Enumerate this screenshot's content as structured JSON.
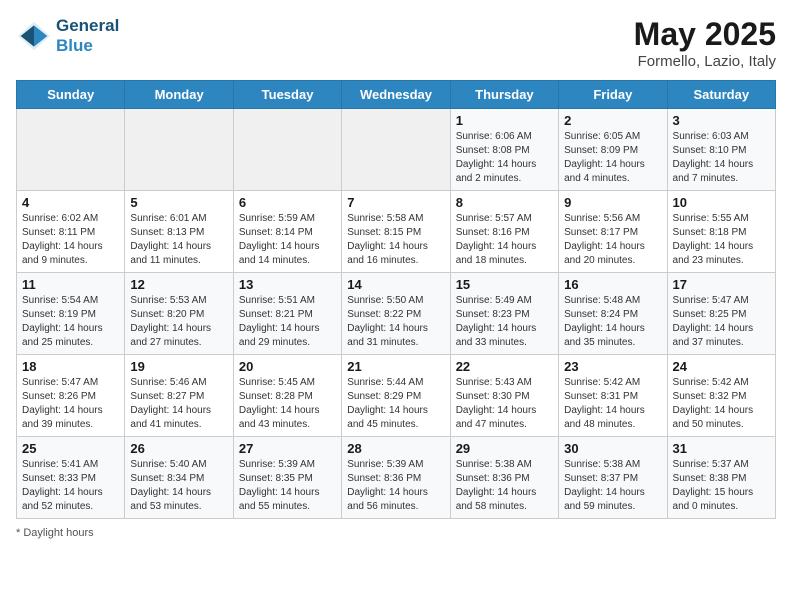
{
  "header": {
    "logo_line1": "General",
    "logo_line2": "Blue",
    "month": "May 2025",
    "location": "Formello, Lazio, Italy"
  },
  "weekdays": [
    "Sunday",
    "Monday",
    "Tuesday",
    "Wednesday",
    "Thursday",
    "Friday",
    "Saturday"
  ],
  "weeks": [
    [
      {
        "day": "",
        "info": ""
      },
      {
        "day": "",
        "info": ""
      },
      {
        "day": "",
        "info": ""
      },
      {
        "day": "",
        "info": ""
      },
      {
        "day": "1",
        "info": "Sunrise: 6:06 AM\nSunset: 8:08 PM\nDaylight: 14 hours\nand 2 minutes."
      },
      {
        "day": "2",
        "info": "Sunrise: 6:05 AM\nSunset: 8:09 PM\nDaylight: 14 hours\nand 4 minutes."
      },
      {
        "day": "3",
        "info": "Sunrise: 6:03 AM\nSunset: 8:10 PM\nDaylight: 14 hours\nand 7 minutes."
      }
    ],
    [
      {
        "day": "4",
        "info": "Sunrise: 6:02 AM\nSunset: 8:11 PM\nDaylight: 14 hours\nand 9 minutes."
      },
      {
        "day": "5",
        "info": "Sunrise: 6:01 AM\nSunset: 8:13 PM\nDaylight: 14 hours\nand 11 minutes."
      },
      {
        "day": "6",
        "info": "Sunrise: 5:59 AM\nSunset: 8:14 PM\nDaylight: 14 hours\nand 14 minutes."
      },
      {
        "day": "7",
        "info": "Sunrise: 5:58 AM\nSunset: 8:15 PM\nDaylight: 14 hours\nand 16 minutes."
      },
      {
        "day": "8",
        "info": "Sunrise: 5:57 AM\nSunset: 8:16 PM\nDaylight: 14 hours\nand 18 minutes."
      },
      {
        "day": "9",
        "info": "Sunrise: 5:56 AM\nSunset: 8:17 PM\nDaylight: 14 hours\nand 20 minutes."
      },
      {
        "day": "10",
        "info": "Sunrise: 5:55 AM\nSunset: 8:18 PM\nDaylight: 14 hours\nand 23 minutes."
      }
    ],
    [
      {
        "day": "11",
        "info": "Sunrise: 5:54 AM\nSunset: 8:19 PM\nDaylight: 14 hours\nand 25 minutes."
      },
      {
        "day": "12",
        "info": "Sunrise: 5:53 AM\nSunset: 8:20 PM\nDaylight: 14 hours\nand 27 minutes."
      },
      {
        "day": "13",
        "info": "Sunrise: 5:51 AM\nSunset: 8:21 PM\nDaylight: 14 hours\nand 29 minutes."
      },
      {
        "day": "14",
        "info": "Sunrise: 5:50 AM\nSunset: 8:22 PM\nDaylight: 14 hours\nand 31 minutes."
      },
      {
        "day": "15",
        "info": "Sunrise: 5:49 AM\nSunset: 8:23 PM\nDaylight: 14 hours\nand 33 minutes."
      },
      {
        "day": "16",
        "info": "Sunrise: 5:48 AM\nSunset: 8:24 PM\nDaylight: 14 hours\nand 35 minutes."
      },
      {
        "day": "17",
        "info": "Sunrise: 5:47 AM\nSunset: 8:25 PM\nDaylight: 14 hours\nand 37 minutes."
      }
    ],
    [
      {
        "day": "18",
        "info": "Sunrise: 5:47 AM\nSunset: 8:26 PM\nDaylight: 14 hours\nand 39 minutes."
      },
      {
        "day": "19",
        "info": "Sunrise: 5:46 AM\nSunset: 8:27 PM\nDaylight: 14 hours\nand 41 minutes."
      },
      {
        "day": "20",
        "info": "Sunrise: 5:45 AM\nSunset: 8:28 PM\nDaylight: 14 hours\nand 43 minutes."
      },
      {
        "day": "21",
        "info": "Sunrise: 5:44 AM\nSunset: 8:29 PM\nDaylight: 14 hours\nand 45 minutes."
      },
      {
        "day": "22",
        "info": "Sunrise: 5:43 AM\nSunset: 8:30 PM\nDaylight: 14 hours\nand 47 minutes."
      },
      {
        "day": "23",
        "info": "Sunrise: 5:42 AM\nSunset: 8:31 PM\nDaylight: 14 hours\nand 48 minutes."
      },
      {
        "day": "24",
        "info": "Sunrise: 5:42 AM\nSunset: 8:32 PM\nDaylight: 14 hours\nand 50 minutes."
      }
    ],
    [
      {
        "day": "25",
        "info": "Sunrise: 5:41 AM\nSunset: 8:33 PM\nDaylight: 14 hours\nand 52 minutes."
      },
      {
        "day": "26",
        "info": "Sunrise: 5:40 AM\nSunset: 8:34 PM\nDaylight: 14 hours\nand 53 minutes."
      },
      {
        "day": "27",
        "info": "Sunrise: 5:39 AM\nSunset: 8:35 PM\nDaylight: 14 hours\nand 55 minutes."
      },
      {
        "day": "28",
        "info": "Sunrise: 5:39 AM\nSunset: 8:36 PM\nDaylight: 14 hours\nand 56 minutes."
      },
      {
        "day": "29",
        "info": "Sunrise: 5:38 AM\nSunset: 8:36 PM\nDaylight: 14 hours\nand 58 minutes."
      },
      {
        "day": "30",
        "info": "Sunrise: 5:38 AM\nSunset: 8:37 PM\nDaylight: 14 hours\nand 59 minutes."
      },
      {
        "day": "31",
        "info": "Sunrise: 5:37 AM\nSunset: 8:38 PM\nDaylight: 15 hours\nand 0 minutes."
      }
    ]
  ],
  "footer": {
    "note": "Daylight hours"
  }
}
